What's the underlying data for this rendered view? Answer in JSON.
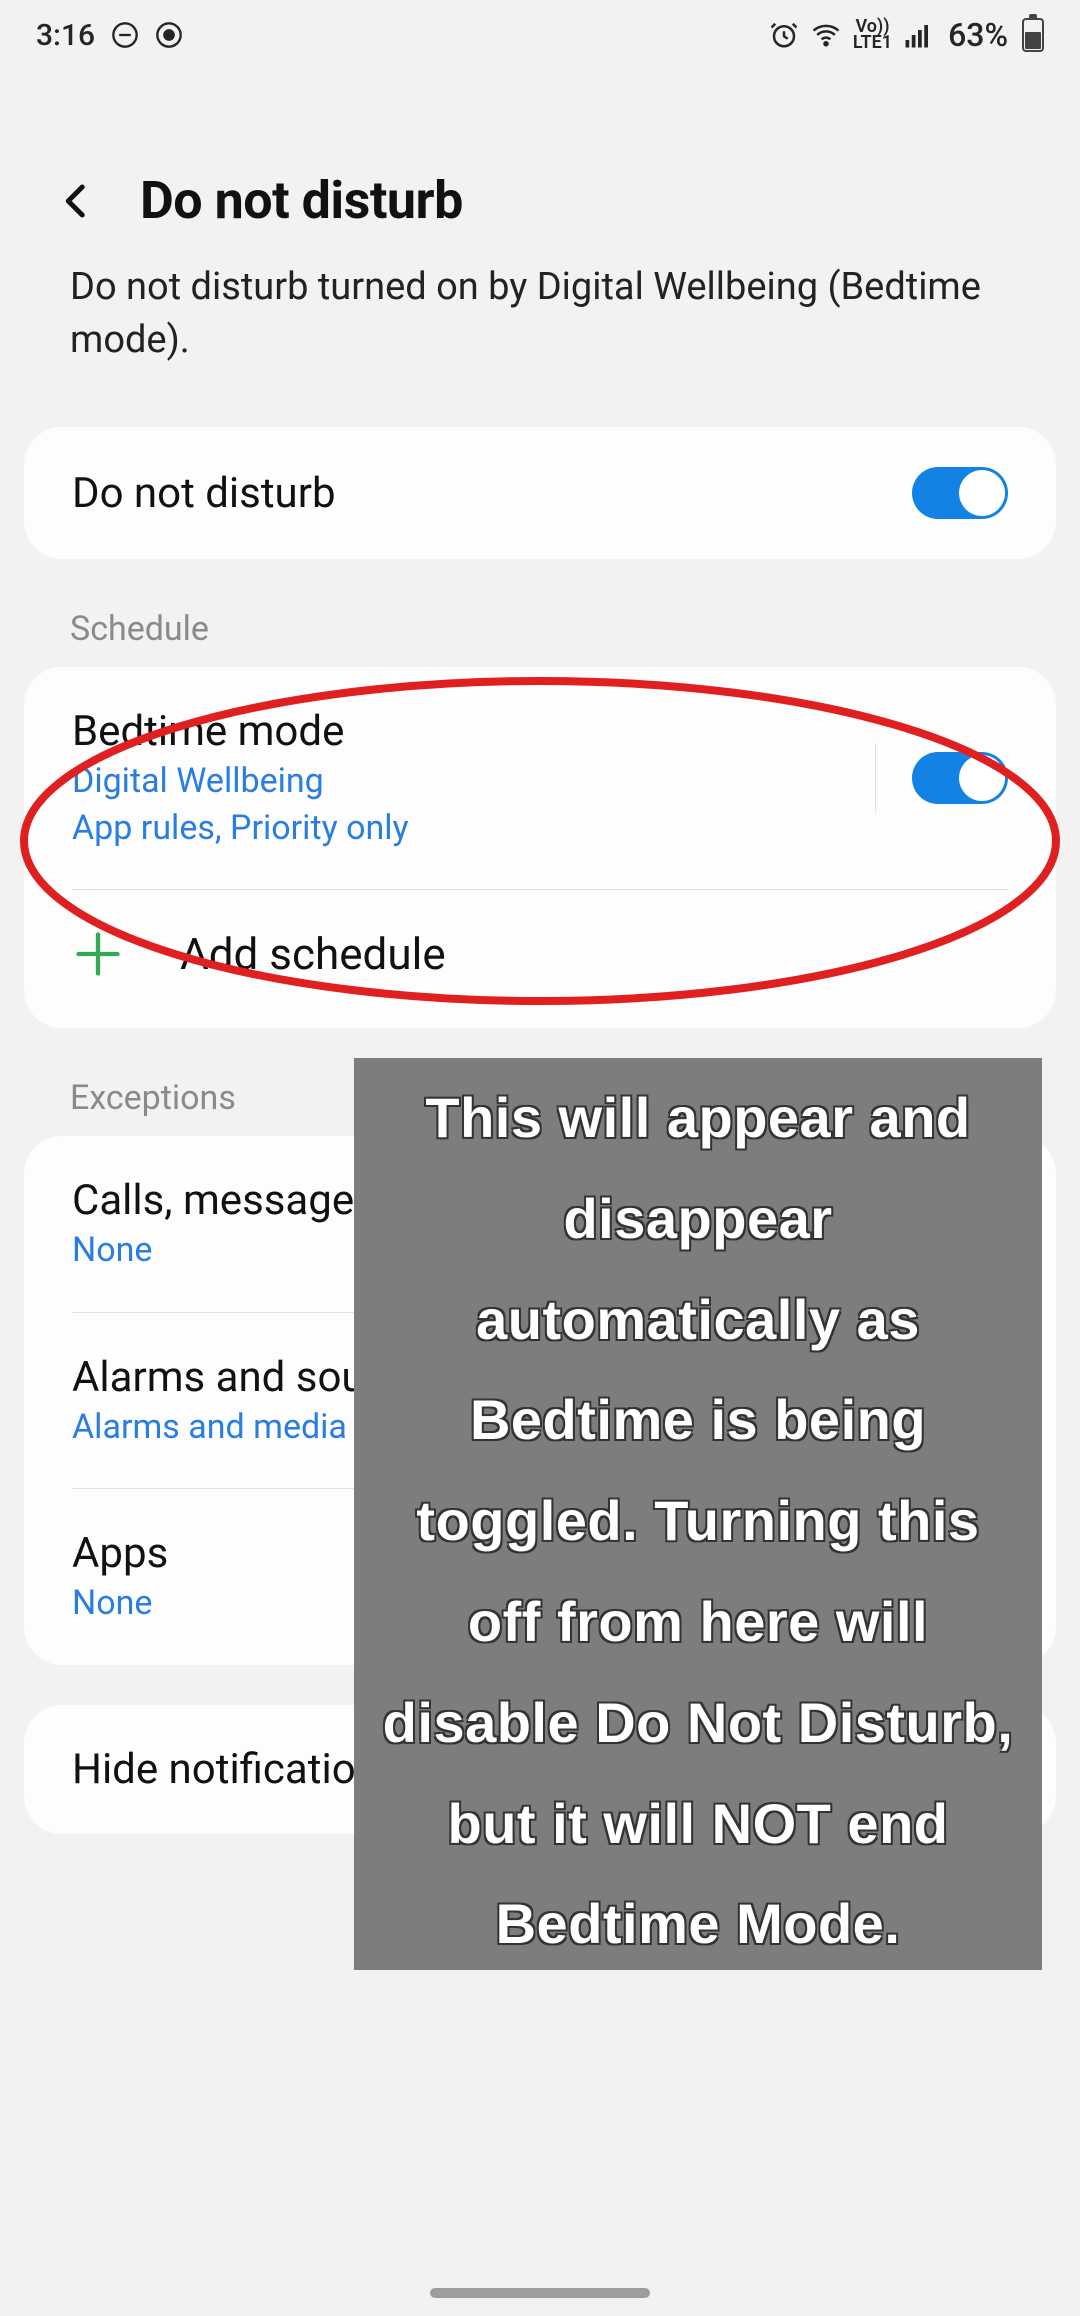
{
  "status": {
    "time": "3:16",
    "battery_pct": "63%"
  },
  "header": {
    "title": "Do not disturb",
    "subtitle": "Do not disturb turned on by Digital Wellbeing (Bedtime mode)."
  },
  "main_toggle": {
    "label": "Do not disturb",
    "on": true
  },
  "sections": {
    "schedule_title": "Schedule",
    "bedtime": {
      "label": "Bedtime mode",
      "sub1": "Digital Wellbeing",
      "sub2": "App rules, Priority only",
      "on": true
    },
    "add_schedule_label": "Add schedule",
    "exceptions_title": "Exceptions",
    "calls": {
      "label": "Calls, messages, and conversations",
      "sub": "None"
    },
    "alarms": {
      "label": "Alarms and sounds",
      "sub": "Alarms and media"
    },
    "apps": {
      "label": "Apps",
      "sub": "None"
    },
    "hide_notifications": {
      "label": "Hide notifications"
    }
  },
  "annotation": {
    "text": "This will appear and disappear automatically as Bedtime is being toggled. Turning this off from here will disable Do Not Disturb, but it will NOT end Bedtime Mode."
  }
}
